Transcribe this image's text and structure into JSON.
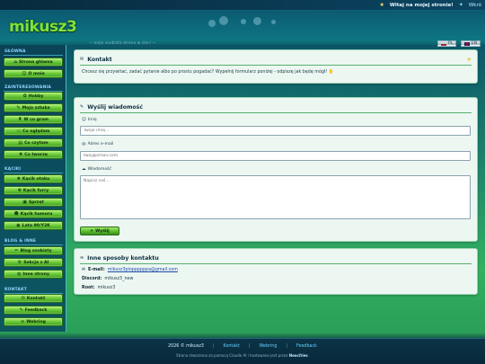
{
  "topbar": {
    "welcome": "Witaj na mojej stronie!",
    "right_link": "Wkró"
  },
  "header": {
    "logo": "mikusz3",
    "tagline": "~ moja osobista strona w sieci ~",
    "lang_pl": "PL",
    "lang_en": "EN"
  },
  "sidebar": {
    "sections": [
      {
        "title": "GŁÓWNA",
        "items": [
          {
            "label": "Strona główna",
            "icon": "home-icon"
          },
          {
            "label": "O mnie",
            "icon": "user-icon"
          }
        ]
      },
      {
        "title": "ZAINTERESOWANIA",
        "items": [
          {
            "label": "Hobby",
            "icon": "palette-icon"
          },
          {
            "label": "Moja sztuka",
            "icon": "brush-icon"
          },
          {
            "label": "W co gram",
            "icon": "gamepad-icon"
          },
          {
            "label": "Co oglądam",
            "icon": "tv-icon"
          },
          {
            "label": "Co czytam",
            "icon": "book-icon"
          },
          {
            "label": "Co tworzę",
            "icon": "wrench-icon"
          }
        ]
      },
      {
        "title": "KĄCIKI",
        "items": [
          {
            "label": "Kącik otaku",
            "icon": "sakura-icon"
          },
          {
            "label": "Kącik furry",
            "icon": "paw-icon"
          },
          {
            "label": "Sprzęt",
            "icon": "computer-icon"
          },
          {
            "label": "Kącik humoru",
            "icon": "smile-icon"
          },
          {
            "label": "Lata 90/Y2K",
            "icon": "disc-icon"
          }
        ]
      },
      {
        "title": "BLOG & INNE",
        "items": [
          {
            "label": "Blog osobisty",
            "icon": "pencil-icon"
          },
          {
            "label": "Sekcja z AI",
            "icon": "robot-icon"
          },
          {
            "label": "Inne strony",
            "icon": "globe-icon"
          }
        ]
      },
      {
        "title": "KONTAKT",
        "items": [
          {
            "label": "Kontakt",
            "icon": "mail-icon"
          },
          {
            "label": "Feedback",
            "icon": "chat-icon"
          },
          {
            "label": "Webring",
            "icon": "link-icon"
          }
        ]
      }
    ]
  },
  "contact_panel": {
    "title": "Kontakt",
    "text": "Chcesz się przywitać, zadać pytanie albo po prostu pogadać? Wypełnij formularz poniżej - odpiszę jak będę mógł!"
  },
  "form_panel": {
    "title": "Wyślij wiadomość",
    "name_label": "Imię",
    "name_placeholder": "Twoje imię...",
    "email_label": "Adres e-mail",
    "email_placeholder": "twoj@email.com",
    "message_label": "Wiadomość",
    "message_placeholder": "Napisz coś...",
    "send_label": "Wyślij"
  },
  "other_panel": {
    "title": "Inne sposoby kontaktu",
    "email_key": "E-mail:",
    "email_value": "mikusz3pioppppppa@gmail.com",
    "discord_key": "Discord:",
    "discord_value": "mikusz3_new",
    "root_key": "Root:",
    "root_value": "mikusz3"
  },
  "footer": {
    "copyright": "2026 © mikusz3",
    "links": [
      "Kontakt",
      "Webring",
      "Feedback"
    ],
    "credit_prefix": "Strona stworzona za pomocą Claude AI i hostowana jest przez",
    "credit_host": "Neocities"
  },
  "colors": {
    "accent_green": "#6dcc3a",
    "header_blue": "#0c5a70",
    "link_blue": "#1a4aa8"
  }
}
